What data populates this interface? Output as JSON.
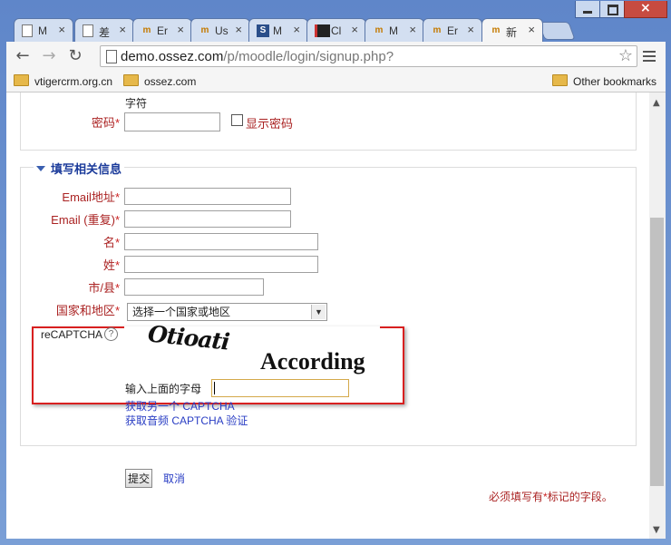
{
  "browser": {
    "tabs": [
      {
        "icon": "page-icon",
        "title": "M"
      },
      {
        "icon": "page-icon",
        "title": "差"
      },
      {
        "icon": "moodle-icon",
        "title": "Er"
      },
      {
        "icon": "moodle-icon",
        "title": "Us"
      },
      {
        "icon": "s-icon",
        "title": "M"
      },
      {
        "icon": "dark-icon",
        "title": "Cl"
      },
      {
        "icon": "moodle-icon",
        "title": "M"
      },
      {
        "icon": "moodle-icon",
        "title": "Er"
      },
      {
        "icon": "moodle-icon",
        "title": "新"
      }
    ],
    "close_glyph": "×",
    "url_host": "demo.ossez.com",
    "url_path": "/p/moodle/login/signup.php?",
    "bookmarks": [
      "vtigercrm.org.cn",
      "ossez.com"
    ],
    "other_bookmarks": "Other bookmarks",
    "nav": {
      "back": "←",
      "forward": "→",
      "reload": "↻"
    },
    "star": "☆",
    "window_close": "×"
  },
  "form": {
    "charset_note": "字符",
    "password_label": "密码",
    "required_mark": "*",
    "show_password_label": "显示密码",
    "section_title": "填写相关信息",
    "email_label": "Email地址",
    "email2_label": "Email (重复)",
    "firstname_label": "名",
    "lastname_label": "姓",
    "city_label": "市/县",
    "country_label": "国家和地区",
    "country_select": "选择一个国家或地区",
    "recaptcha_label": "reCAPTCHA",
    "help_glyph": "?",
    "captcha_word1": "Otioati",
    "captcha_word2": "According",
    "captcha_prompt": "输入上面的字母",
    "captcha_another": "获取另一个 CAPTCHA",
    "captcha_audio": "获取音频 CAPTCHA 验证",
    "submit_label": "提交",
    "cancel_label": "取消",
    "required_note_before": "必须填写有",
    "required_note_after": "标记的字段。"
  },
  "colors": {
    "required": "#cc2222",
    "link": "#2a3ec4",
    "highlight_box": "#d82020"
  }
}
